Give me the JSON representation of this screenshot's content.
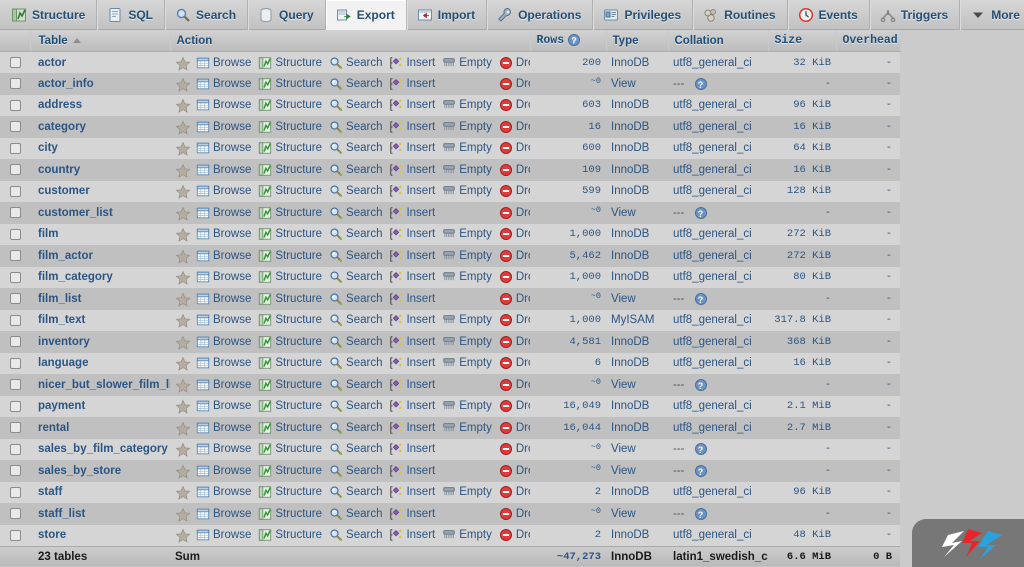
{
  "tabs": [
    {
      "label": "Structure",
      "icon": "structure-icon",
      "active": false
    },
    {
      "label": "SQL",
      "icon": "sql-icon",
      "active": false
    },
    {
      "label": "Search",
      "icon": "search-icon",
      "active": false
    },
    {
      "label": "Query",
      "icon": "query-icon",
      "active": false
    },
    {
      "label": "Export",
      "icon": "export-icon",
      "active": true
    },
    {
      "label": "Import",
      "icon": "import-icon",
      "active": false
    },
    {
      "label": "Operations",
      "icon": "wrench-icon",
      "active": false
    },
    {
      "label": "Privileges",
      "icon": "privileges-icon",
      "active": false
    },
    {
      "label": "Routines",
      "icon": "routines-icon",
      "active": false
    },
    {
      "label": "Events",
      "icon": "clock-icon",
      "active": false
    },
    {
      "label": "Triggers",
      "icon": "triggers-icon",
      "active": false
    },
    {
      "label": "More",
      "icon": "chevron-down-icon",
      "active": false
    }
  ],
  "columns": {
    "table": "Table",
    "action": "Action",
    "rows": "Rows",
    "type": "Type",
    "collation": "Collation",
    "size": "Size",
    "overhead": "Overhead"
  },
  "action_labels": {
    "browse": "Browse",
    "structure": "Structure",
    "search": "Search",
    "insert": "Insert",
    "empty": "Empty",
    "drop": "Drop"
  },
  "approx_marker": "~0",
  "rows": [
    {
      "name": "actor",
      "rows": "200",
      "approx": false,
      "empty": true,
      "drop_approx": false,
      "type": "InnoDB",
      "collation": "utf8_general_ci",
      "size": "32 KiB",
      "overhead": "-"
    },
    {
      "name": "actor_info",
      "rows": "",
      "approx": true,
      "empty": false,
      "drop_approx": true,
      "type": "View",
      "collation": "---",
      "size": "-",
      "overhead": "-"
    },
    {
      "name": "address",
      "rows": "603",
      "approx": false,
      "empty": true,
      "drop_approx": false,
      "type": "InnoDB",
      "collation": "utf8_general_ci",
      "size": "96 KiB",
      "overhead": "-"
    },
    {
      "name": "category",
      "rows": "16",
      "approx": false,
      "empty": true,
      "drop_approx": false,
      "type": "InnoDB",
      "collation": "utf8_general_ci",
      "size": "16 KiB",
      "overhead": "-"
    },
    {
      "name": "city",
      "rows": "600",
      "approx": false,
      "empty": true,
      "drop_approx": false,
      "type": "InnoDB",
      "collation": "utf8_general_ci",
      "size": "64 KiB",
      "overhead": "-"
    },
    {
      "name": "country",
      "rows": "109",
      "approx": false,
      "empty": true,
      "drop_approx": false,
      "type": "InnoDB",
      "collation": "utf8_general_ci",
      "size": "16 KiB",
      "overhead": "-"
    },
    {
      "name": "customer",
      "rows": "599",
      "approx": false,
      "empty": true,
      "drop_approx": false,
      "type": "InnoDB",
      "collation": "utf8_general_ci",
      "size": "128 KiB",
      "overhead": "-"
    },
    {
      "name": "customer_list",
      "rows": "",
      "approx": true,
      "empty": false,
      "drop_approx": true,
      "type": "View",
      "collation": "---",
      "size": "-",
      "overhead": "-"
    },
    {
      "name": "film",
      "rows": "1,000",
      "approx": false,
      "empty": true,
      "drop_approx": false,
      "type": "InnoDB",
      "collation": "utf8_general_ci",
      "size": "272 KiB",
      "overhead": "-"
    },
    {
      "name": "film_actor",
      "rows": "5,462",
      "approx": false,
      "empty": true,
      "drop_approx": false,
      "type": "InnoDB",
      "collation": "utf8_general_ci",
      "size": "272 KiB",
      "overhead": "-"
    },
    {
      "name": "film_category",
      "rows": "1,000",
      "approx": false,
      "empty": true,
      "drop_approx": false,
      "type": "InnoDB",
      "collation": "utf8_general_ci",
      "size": "80 KiB",
      "overhead": "-"
    },
    {
      "name": "film_list",
      "rows": "",
      "approx": true,
      "empty": false,
      "drop_approx": true,
      "type": "View",
      "collation": "---",
      "size": "-",
      "overhead": "-"
    },
    {
      "name": "film_text",
      "rows": "1,000",
      "approx": false,
      "empty": true,
      "drop_approx": false,
      "type": "MyISAM",
      "collation": "utf8_general_ci",
      "size": "317.8 KiB",
      "overhead": "-"
    },
    {
      "name": "inventory",
      "rows": "4,581",
      "approx": false,
      "empty": true,
      "drop_approx": false,
      "type": "InnoDB",
      "collation": "utf8_general_ci",
      "size": "368 KiB",
      "overhead": "-"
    },
    {
      "name": "language",
      "rows": "6",
      "approx": false,
      "empty": true,
      "drop_approx": false,
      "type": "InnoDB",
      "collation": "utf8_general_ci",
      "size": "16 KiB",
      "overhead": "-"
    },
    {
      "name": "nicer_but_slower_film_list",
      "rows": "",
      "approx": true,
      "empty": false,
      "drop_approx": true,
      "type": "View",
      "collation": "---",
      "size": "-",
      "overhead": "-"
    },
    {
      "name": "payment",
      "rows": "16,049",
      "approx": false,
      "empty": true,
      "drop_approx": false,
      "type": "InnoDB",
      "collation": "utf8_general_ci",
      "size": "2.1 MiB",
      "overhead": "-"
    },
    {
      "name": "rental",
      "rows": "16,044",
      "approx": false,
      "empty": true,
      "drop_approx": false,
      "type": "InnoDB",
      "collation": "utf8_general_ci",
      "size": "2.7 MiB",
      "overhead": "-"
    },
    {
      "name": "sales_by_film_category",
      "rows": "",
      "approx": true,
      "empty": false,
      "drop_approx": true,
      "type": "View",
      "collation": "---",
      "size": "-",
      "overhead": "-"
    },
    {
      "name": "sales_by_store",
      "rows": "",
      "approx": true,
      "empty": false,
      "drop_approx": true,
      "type": "View",
      "collation": "---",
      "size": "-",
      "overhead": "-"
    },
    {
      "name": "staff",
      "rows": "2",
      "approx": false,
      "empty": true,
      "drop_approx": false,
      "type": "InnoDB",
      "collation": "utf8_general_ci",
      "size": "96 KiB",
      "overhead": "-"
    },
    {
      "name": "staff_list",
      "rows": "",
      "approx": true,
      "empty": false,
      "drop_approx": true,
      "type": "View",
      "collation": "---",
      "size": "-",
      "overhead": "-"
    },
    {
      "name": "store",
      "rows": "2",
      "approx": false,
      "empty": true,
      "drop_approx": false,
      "type": "InnoDB",
      "collation": "utf8_general_ci",
      "size": "48 KiB",
      "overhead": "-"
    }
  ],
  "summary": {
    "table_count": "23 tables",
    "action": "Sum",
    "rows": "~47,273",
    "type": "InnoDB",
    "collation": "latin1_swedish_ci",
    "size": "6.6 MiB",
    "overhead": "0 B"
  },
  "colors": {
    "link": "#2b5584",
    "header_text": "#1f4e79",
    "row_odd": "#d5d5d5",
    "row_even": "#c0c0c0",
    "page_bg": "#cbcbcb",
    "tab_active_bg": "#f2f2f2"
  }
}
